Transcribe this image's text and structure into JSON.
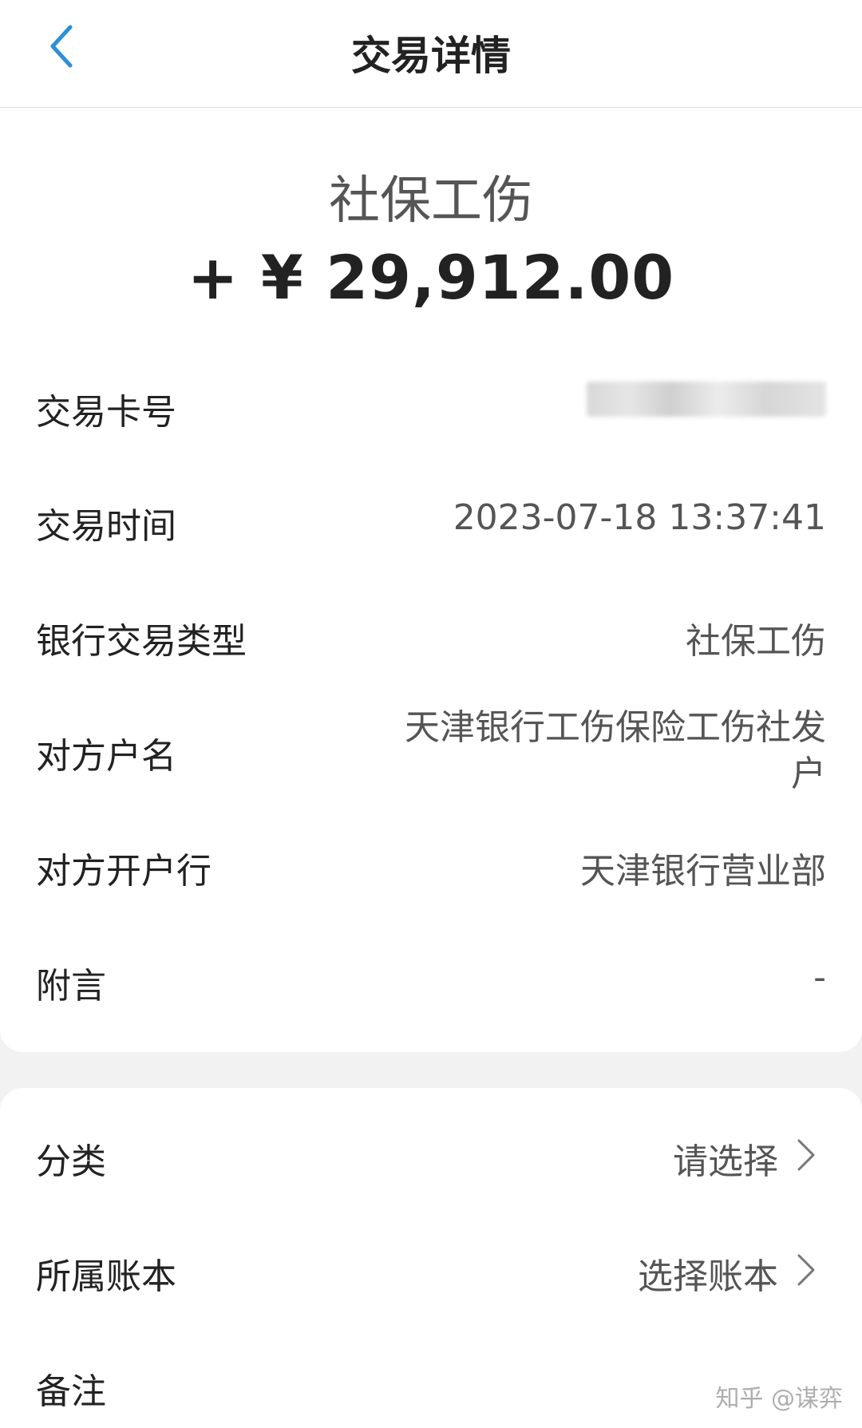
{
  "header": {
    "title": "交易详情"
  },
  "summary": {
    "type": "社保工伤",
    "amount": "+ ¥ 29,912.00"
  },
  "details": {
    "card_number_label": "交易卡号",
    "time_label": "交易时间",
    "time_value": "2023-07-18 13:37:41",
    "bank_type_label": "银行交易类型",
    "bank_type_value": "社保工伤",
    "counterparty_label": "对方户名",
    "counterparty_value_line1": "天津银行工伤保险工伤社发",
    "counterparty_value_line2": "户",
    "counterparty_bank_label": "对方开户行",
    "counterparty_bank_value": "天津银行营业部",
    "memo_label": "附言",
    "memo_value": "-"
  },
  "actions": {
    "category_label": "分类",
    "category_value": "请选择",
    "ledger_label": "所属账本",
    "ledger_value": "选择账本",
    "note_label": "备注"
  },
  "watermark": "知乎 @谋弈",
  "colors": {
    "accent": "#2f8fd8",
    "background": "#f2f2f2",
    "card": "#ffffff"
  },
  "icons": {
    "back": "chevron-left-icon",
    "row_arrow": "chevron-right-icon"
  }
}
